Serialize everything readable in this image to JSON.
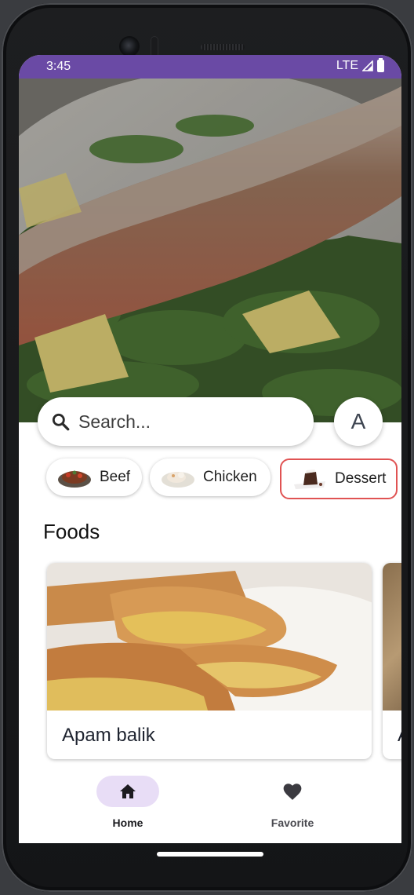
{
  "status_bar": {
    "time": "3:45",
    "network": "LTE"
  },
  "search": {
    "placeholder": "Search..."
  },
  "avatar": {
    "initial": "A"
  },
  "categories": [
    {
      "label": "Beef",
      "icon": "beef-dish-icon"
    },
    {
      "label": "Chicken",
      "icon": "chicken-dish-icon"
    },
    {
      "label": "Dessert",
      "icon": "dessert-dish-icon",
      "selected": true
    }
  ],
  "section": {
    "title": "Foods"
  },
  "foods": [
    {
      "name": "Apam balik"
    },
    {
      "name": "A"
    }
  ],
  "bottom_nav": [
    {
      "label": "Home",
      "icon": "home-icon",
      "active": true
    },
    {
      "label": "Favorite",
      "icon": "heart-icon",
      "active": false
    }
  ],
  "colors": {
    "status_bar": "#6a4aa5",
    "nav_active_pill": "#e8ddf6",
    "selected_chip_border": "#e05353"
  }
}
